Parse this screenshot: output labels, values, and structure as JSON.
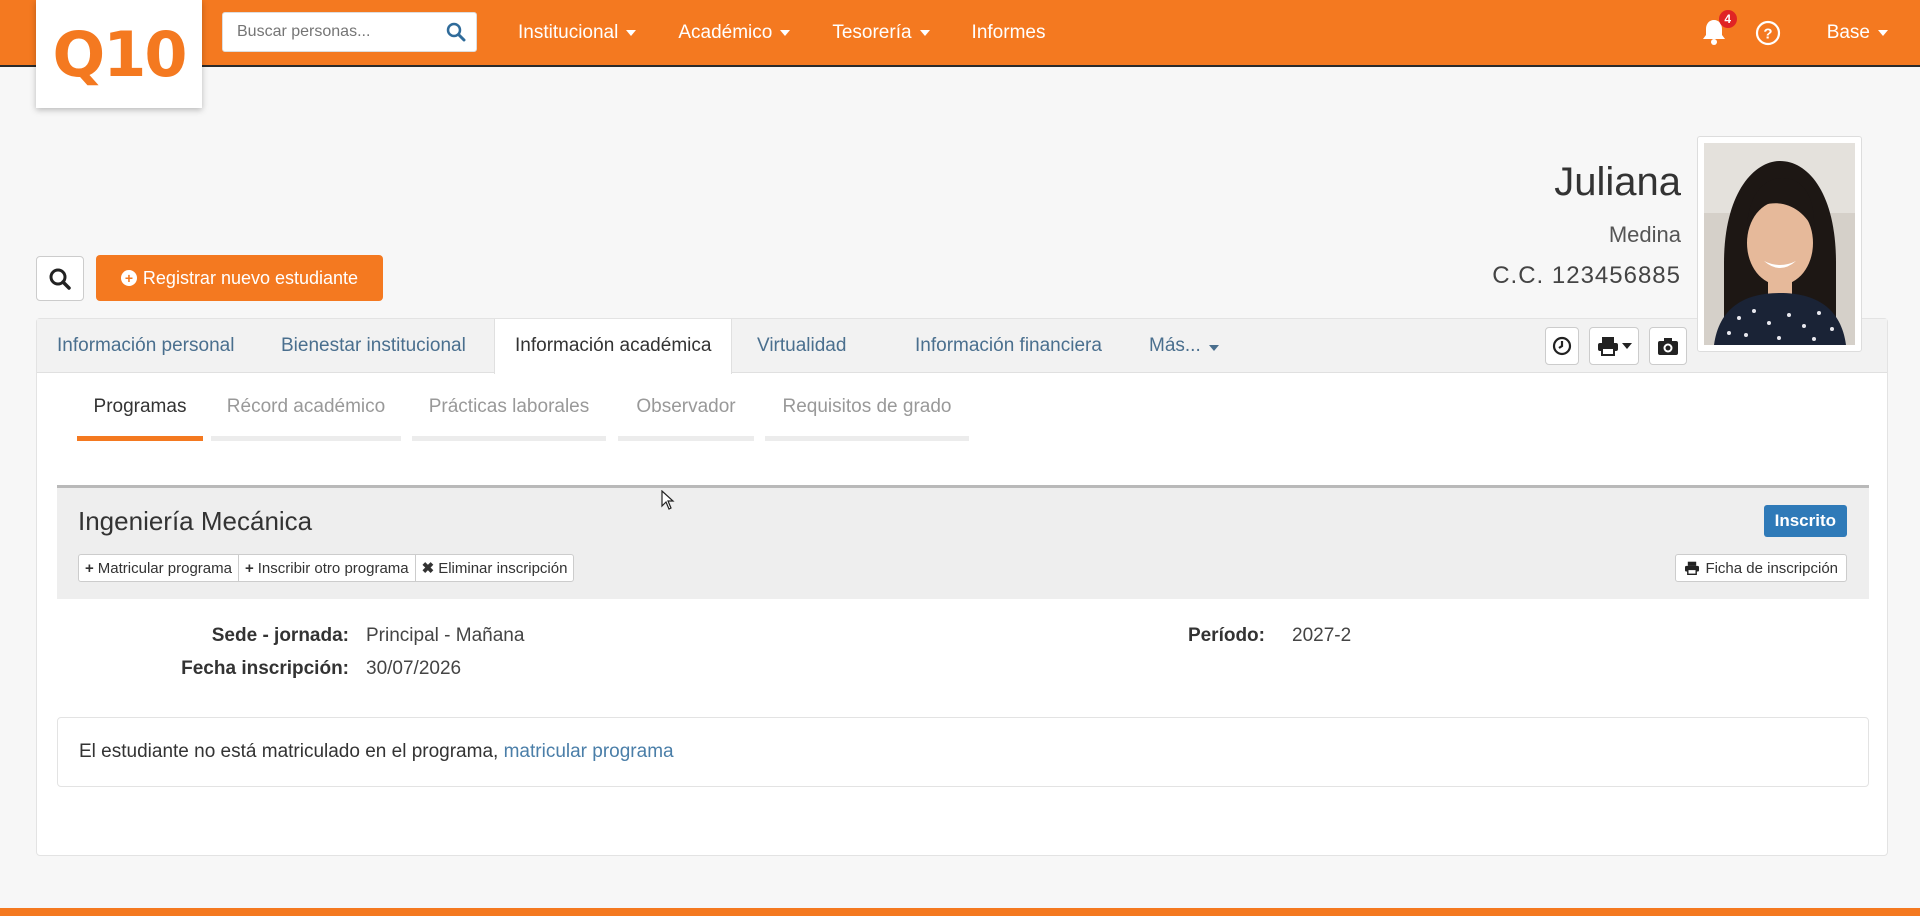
{
  "brand": {
    "logo_text": "Q10",
    "accent_color": "#f47920",
    "link_color": "#4a6f8e",
    "status_color": "#2f7ab8"
  },
  "search": {
    "placeholder": "Buscar personas...",
    "icon": "search-icon"
  },
  "nav": {
    "items": [
      {
        "label": "Institucional",
        "has_dropdown": true
      },
      {
        "label": "Académico",
        "has_dropdown": true
      },
      {
        "label": "Tesorería",
        "has_dropdown": true
      },
      {
        "label": "Informes",
        "has_dropdown": false
      }
    ],
    "notifications_count": "4",
    "user_label": "Base"
  },
  "student": {
    "first_name": "Juliana",
    "last_name": "Medina",
    "document": "C.C. 123456885"
  },
  "actions": {
    "register_label": "Registrar nuevo estudiante"
  },
  "tabs": [
    {
      "label": "Información personal",
      "active": false
    },
    {
      "label": "Bienestar institucional",
      "active": false
    },
    {
      "label": "Información académica",
      "active": true
    },
    {
      "label": "Virtualidad",
      "active": false
    },
    {
      "label": "Información financiera",
      "active": false
    },
    {
      "label": "Más...",
      "active": false
    }
  ],
  "subtabs": [
    {
      "label": "Programas",
      "active": true
    },
    {
      "label": "Récord académico",
      "active": false
    },
    {
      "label": "Prácticas laborales",
      "active": false
    },
    {
      "label": "Observador",
      "active": false
    },
    {
      "label": "Requisitos de grado",
      "active": false
    }
  ],
  "program": {
    "name": "Ingeniería Mecánica",
    "status": "Inscrito",
    "buttons": {
      "enroll": "Matricular programa",
      "register_other": "Inscribir otro programa",
      "delete": "Eliminar inscripción",
      "form": "Ficha de inscripción"
    },
    "fields": {
      "campus_label": "Sede - jornada:",
      "campus_value": "Principal - Mañana",
      "date_label": "Fecha inscripción:",
      "date_value": "30/07/2026",
      "period_label": "Período:",
      "period_value": "2027-2"
    },
    "notice_text": "El estudiante no está matriculado en el programa,",
    "notice_link": "matricular programa"
  }
}
